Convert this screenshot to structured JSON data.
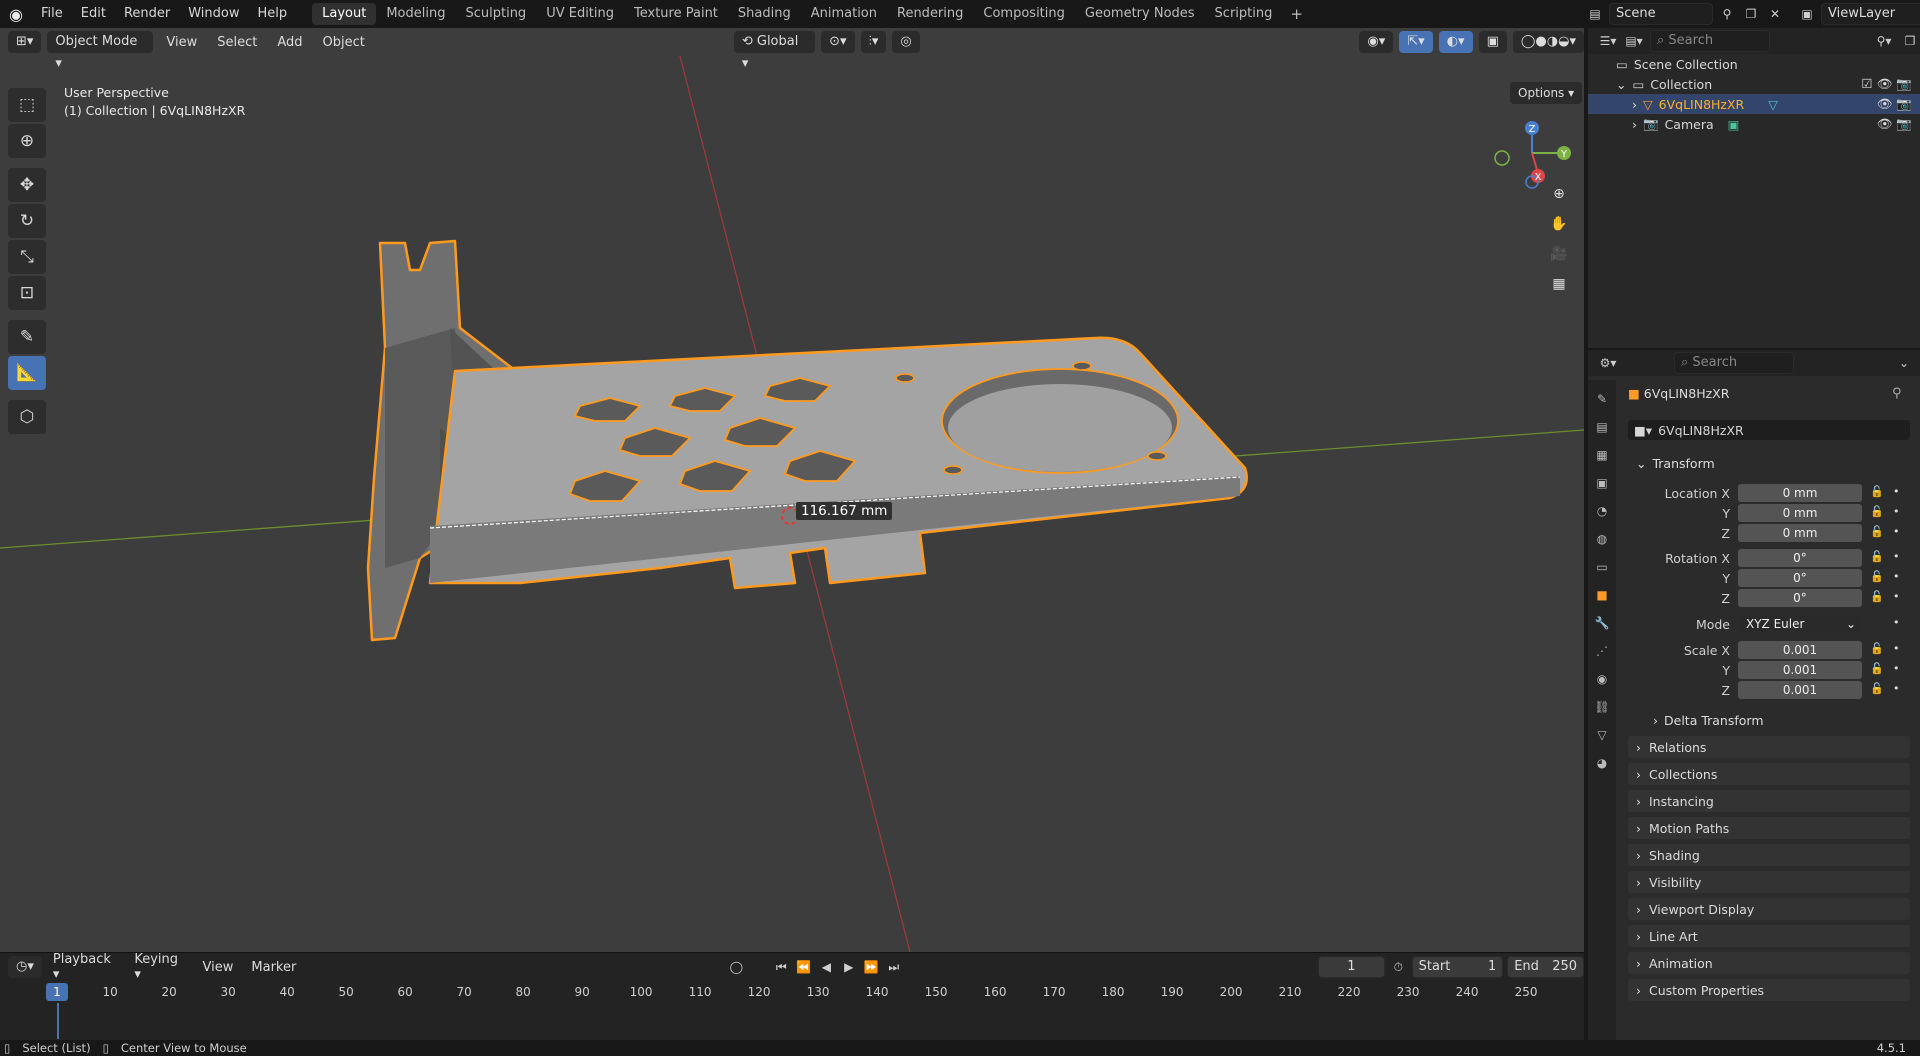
{
  "topbar": {
    "menus": [
      "File",
      "Edit",
      "Render",
      "Window",
      "Help"
    ],
    "workspaces": [
      "Layout",
      "Modeling",
      "Sculpting",
      "UV Editing",
      "Texture Paint",
      "Shading",
      "Animation",
      "Rendering",
      "Compositing",
      "Geometry Nodes",
      "Scripting"
    ],
    "active_workspace": "Layout",
    "scene": "Scene",
    "view_layer": "ViewLayer"
  },
  "viewport": {
    "mode": "Object Mode",
    "menus": [
      "View",
      "Select",
      "Add",
      "Object"
    ],
    "transform_orientation": "Global",
    "options_label": "Options",
    "info_line1": "User Perspective",
    "info_line2": "(1) Collection | 6VqLIN8HzXR",
    "measurement": "116.167 mm",
    "gizmo": {
      "x": "X",
      "y": "Y",
      "z": "Z"
    }
  },
  "outliner": {
    "search_placeholder": "Search",
    "scene_collection": "Scene Collection",
    "collection": "Collection",
    "object": "6VqLIN8HzXR",
    "camera": "Camera"
  },
  "properties": {
    "search_placeholder": "Search",
    "object_name": "6VqLIN8HzXR",
    "transform_title": "Transform",
    "location_label": "Location X",
    "location": [
      "0 mm",
      "0 mm",
      "0 mm"
    ],
    "rotation_label": "Rotation X",
    "rotation": [
      "0°",
      "0°",
      "0°"
    ],
    "mode_label": "Mode",
    "mode_value": "XYZ Euler",
    "scale_label": "Scale X",
    "scale": [
      "0.001",
      "0.001",
      "0.001"
    ],
    "y_label": "Y",
    "z_label": "Z",
    "delta_transform": "Delta Transform",
    "sections": [
      "Relations",
      "Collections",
      "Instancing",
      "Motion Paths",
      "Shading",
      "Visibility",
      "Viewport Display",
      "Line Art",
      "Animation",
      "Custom Properties"
    ]
  },
  "timeline": {
    "menus": [
      "Playback",
      "Keying",
      "View",
      "Marker"
    ],
    "current_frame": "1",
    "start_label": "Start",
    "start": "1",
    "end_label": "End",
    "end": "250",
    "ruler": [
      "1",
      "10",
      "20",
      "30",
      "40",
      "50",
      "60",
      "70",
      "80",
      "90",
      "100",
      "110",
      "120",
      "130",
      "140",
      "150",
      "160",
      "170",
      "180",
      "190",
      "200",
      "210",
      "220",
      "230",
      "240",
      "250"
    ]
  },
  "status": {
    "select": "Select (List)",
    "center": "Center View to Mouse",
    "version": "4.5.1"
  },
  "colors": {
    "selection_outline": "#ff9a1f",
    "viewport_bg": "#3d3d3d",
    "accent": "#4772b3"
  }
}
